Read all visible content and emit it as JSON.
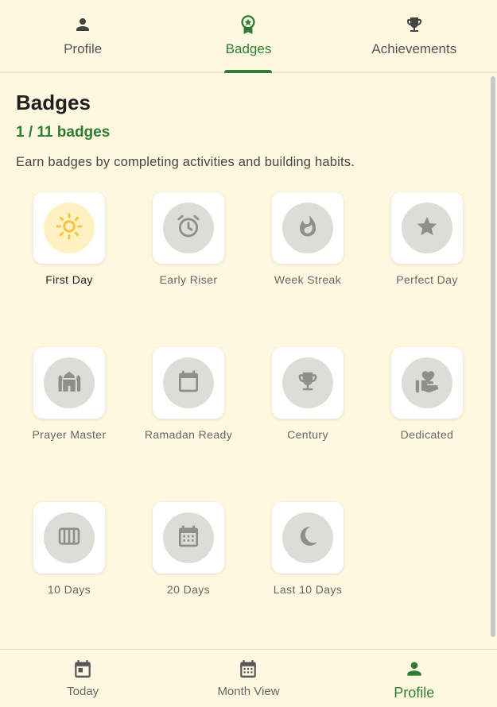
{
  "tabs": {
    "profile": "Profile",
    "badges": "Badges",
    "achievements": "Achievements"
  },
  "header": {
    "title": "Badges",
    "count": "1 / 11 badges",
    "description": "Earn badges by completing activities and building habits."
  },
  "badges": [
    {
      "name": "First Day",
      "icon": "sun-icon",
      "earned": true
    },
    {
      "name": "Early Riser",
      "icon": "alarm-clock-icon",
      "earned": false
    },
    {
      "name": "Week Streak",
      "icon": "fire-icon",
      "earned": false
    },
    {
      "name": "Perfect Day",
      "icon": "star-icon",
      "earned": false
    },
    {
      "name": "Prayer Master",
      "icon": "mosque-icon",
      "earned": false
    },
    {
      "name": "Ramadan Ready",
      "icon": "calendar-blank-icon",
      "earned": false
    },
    {
      "name": "Century",
      "icon": "trophy-icon",
      "earned": false
    },
    {
      "name": "Dedicated",
      "icon": "heart-hand-icon",
      "earned": false
    },
    {
      "name": "10 Days",
      "icon": "view-week-icon",
      "earned": false
    },
    {
      "name": "20 Days",
      "icon": "calendar-month-icon",
      "earned": false
    },
    {
      "name": "Last 10 Days",
      "icon": "moon-icon",
      "earned": false
    }
  ],
  "bottom_nav": {
    "today": "Today",
    "month_view": "Month View",
    "profile": "Profile"
  },
  "colors": {
    "background": "#fff8e1",
    "accent": "#2e7d32",
    "earned_icon": "#f9c23c",
    "locked_icon": "#8e8f88"
  }
}
